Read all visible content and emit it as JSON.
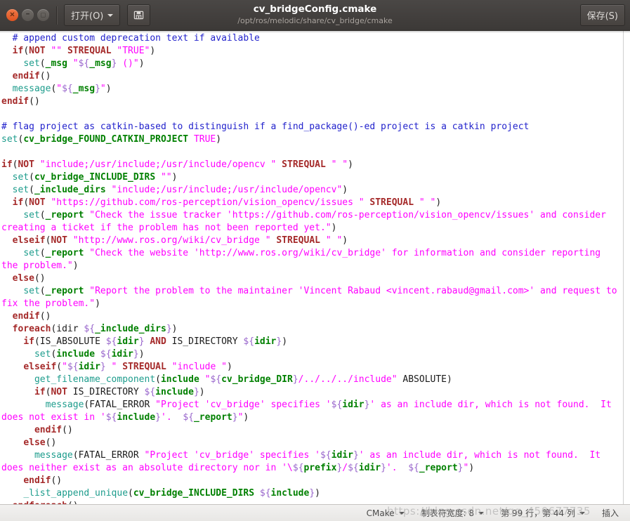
{
  "window": {
    "title": "cv_bridgeConfig.cmake",
    "subtitle": "/opt/ros/melodic/share/cv_bridge/cmake",
    "controls": {
      "close_glyph": "×",
      "minimize_glyph": "–",
      "maximize_glyph": "□"
    }
  },
  "toolbar": {
    "open_label": "打开(O)",
    "save_as_label": "",
    "save_label": "保存(S)"
  },
  "editor": {
    "language": "CMake",
    "lines": [
      "  # append custom deprecation text if available",
      "  if(NOT \"\" STREQUAL \"TRUE\")",
      "    set(_msg \"${_msg} ()\")",
      "  endif()",
      "  message(\"${_msg}\")",
      "endif()",
      "",
      "# flag project as catkin-based to distinguish if a find_package()-ed project is a catkin project",
      "set(cv_bridge_FOUND_CATKIN_PROJECT TRUE)",
      "",
      "if(NOT \"include;/usr/include;/usr/include/opencv \" STREQUAL \" \")",
      "  set(cv_bridge_INCLUDE_DIRS \"\")",
      "  set(_include_dirs \"include;/usr/include;/usr/include/opencv\")",
      "  if(NOT \"https://github.com/ros-perception/vision_opencv/issues \" STREQUAL \" \")",
      "    set(_report \"Check the issue tracker 'https://github.com/ros-perception/vision_opencv/issues' and consider creating a ticket if the problem has not been reported yet.\")",
      "  elseif(NOT \"http://www.ros.org/wiki/cv_bridge \" STREQUAL \" \")",
      "    set(_report \"Check the website 'http://www.ros.org/wiki/cv_bridge' for information and consider reporting the problem.\")",
      "  else()",
      "    set(_report \"Report the problem to the maintainer 'Vincent Rabaud <vincent.rabaud@gmail.com>' and request to fix the problem.\")",
      "  endif()",
      "  foreach(idir ${_include_dirs})",
      "    if(IS_ABSOLUTE ${idir} AND IS_DIRECTORY ${idir})",
      "      set(include ${idir})",
      "    elseif(\"${idir} \" STREQUAL \"include \")",
      "      get_filename_component(include \"${cv_bridge_DIR}/../../../include\" ABSOLUTE)",
      "      if(NOT IS_DIRECTORY ${include})",
      "        message(FATAL_ERROR \"Project 'cv_bridge' specifies '${idir}' as an include dir, which is not found.  It does not exist in '${include}'.  ${_report}\")",
      "      endif()",
      "    else()",
      "      message(FATAL_ERROR \"Project 'cv_bridge' specifies '${idir}' as an include dir, which is not found.  It does neither exist as an absolute directory nor in '\\${prefix}/${idir}'.  ${_report}\")",
      "    endif()",
      "    _list_append_unique(cv_bridge_INCLUDE_DIRS ${include})",
      "  endforeach()"
    ]
  },
  "statusbar": {
    "language": "CMake",
    "tab_width_label": "制表符宽度: 8",
    "position_label": "第 99 行，第 44 列",
    "insert_mode": "插入",
    "watermark": "https://blog.csdn.net/qq_450677735"
  },
  "colors": {
    "titlebar_bg": "#3c3937",
    "close_button": "#e35f27",
    "comment": "#2222cc",
    "keyword": "#a52a2a",
    "function": "#1d9c8c",
    "string": "#ff00ff",
    "variable": "#008000",
    "dollar_brace": "#9966cc",
    "editor_bg": "#ffffff",
    "statusbar_bg": "#eeedec"
  }
}
